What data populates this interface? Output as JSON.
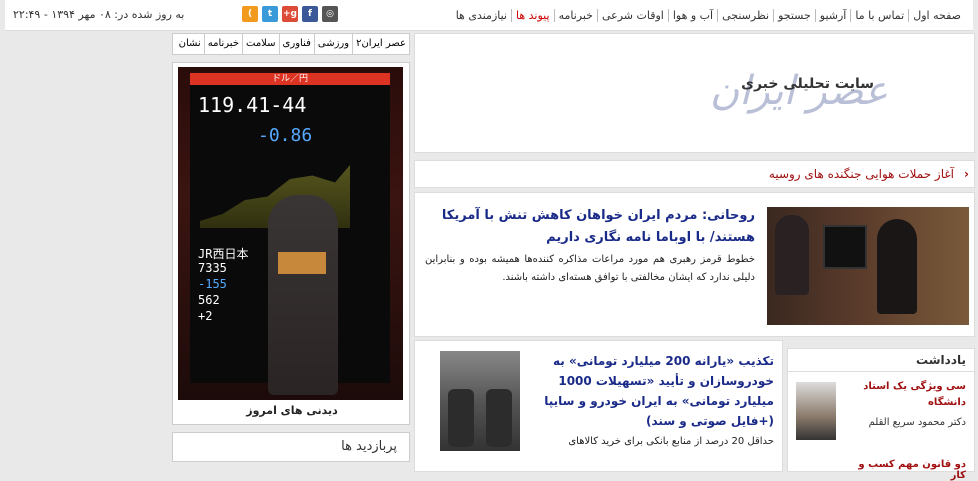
{
  "topbar": {
    "nav": [
      "صفحه اول",
      "تماس با ما",
      "آرشیو",
      "جستجو",
      "نظرسنجی",
      "آب و هوا",
      "اوقات شرعی",
      "خبرنامه",
      "پیوند ها",
      "نیازمندی ها"
    ],
    "updated": "به روز شده در: ۰۸ مهر ۱۳۹۴ - ۲۲:۴۹",
    "social": [
      "instagram-icon",
      "facebook-icon",
      "google-plus-icon",
      "twitter-icon",
      "rss-icon"
    ]
  },
  "leftcol": {
    "tabs": [
      "عصر ایران۲",
      "ورزشی",
      "فناوری",
      "سلامت",
      "خبرنامه",
      "نشان"
    ],
    "photo": {
      "caption": "دیدنی های امروز",
      "screen_header": "ドル／円",
      "quote_value": "119.41-44",
      "quote_change": "-0.86",
      "board_rows": [
        "JR西日本",
        "7335",
        "-155",
        "562",
        "+2"
      ]
    },
    "box2_title": "پربازدید ها"
  },
  "main": {
    "logo_title": "عصر ایران",
    "logo_subtitle": "سایت تحلیلی خبری",
    "ticker": "آغاز حملات هوایی جنگنده های روسیه",
    "story1": {
      "title": "روحانی: مردم ایران خواهان کاهش تنش با آمریکا هستند/ با اوباما نامه نگاری داریم",
      "body": "خطوط قرمز رهبری هم مورد مراعات مذاکره کنندەها همیشه بوده و بنابراین دلیلی ندارد که ایشان مخالفتی با توافق هسته‌ای داشته باشند."
    },
    "story2": {
      "title": "تکذیب «یارانه 200 میلیارد تومانی» به خودروسازان و تأیید «تسهیلات 1000 میلیارد تومانی» به ایران خودرو و سایپا (+فایل صوتی و سند)",
      "body": "حداقل 20 درصد از منابع بانکی برای خرید کالاهای"
    },
    "notes": {
      "header": "یادداشت",
      "item_title": "سی ویژگی یک استاد دانشگاه",
      "item_author": "دکتر محمود سریع القلم",
      "item2_title": "دو قانون مهم کسب و کار"
    }
  }
}
